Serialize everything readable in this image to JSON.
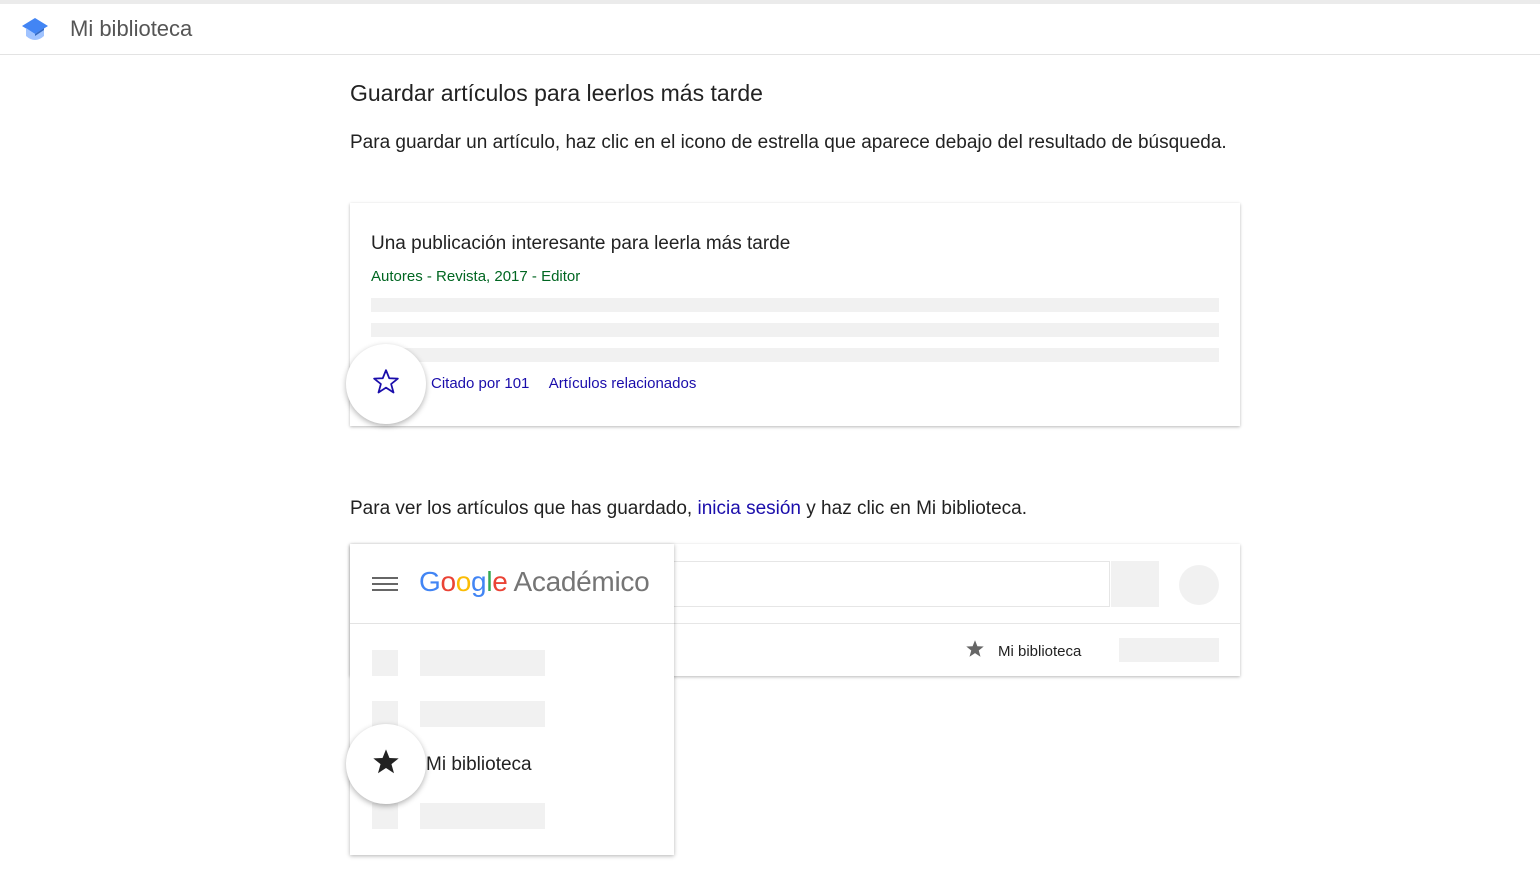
{
  "header": {
    "title": "Mi biblioteca",
    "logo_icon": "graduation-cap-icon",
    "logo_colors": [
      "#4285f4",
      "#a0c3ff",
      "#356ac3"
    ]
  },
  "main": {
    "heading": "Guardar artículos para leerlos más tarde",
    "instruction_save": "Para guardar un artículo, haz clic en el icono de estrella que aparece debajo del resultado de búsqueda.",
    "example_result": {
      "title": "Una publicación interesante para leerla más tarde",
      "meta": "Autores - Revista, 2017 - Editor",
      "cited_by": "Citado por 101",
      "related": "Artículos relacionados",
      "star_icon": "star-outline-icon"
    },
    "instruction_view": {
      "before": "Para ver los artículos que has guardado,",
      "link": "inicia sesión",
      "after": "y haz clic en Mi biblioteca."
    },
    "example_topbar": {
      "my_library_label": "Mi biblioteca",
      "star_icon": "star-filled-icon"
    },
    "example_drawer": {
      "menu_icon": "hamburger-menu-icon",
      "brand_google": [
        "G",
        "o",
        "o",
        "g",
        "l",
        "e"
      ],
      "brand_product": "Académico",
      "my_library_label": "Mi biblioteca",
      "star_icon": "star-filled-icon"
    }
  },
  "colors": {
    "link": "#1a0dab",
    "meta_green": "#006621",
    "placeholder_gray": "#f1f1f1"
  }
}
